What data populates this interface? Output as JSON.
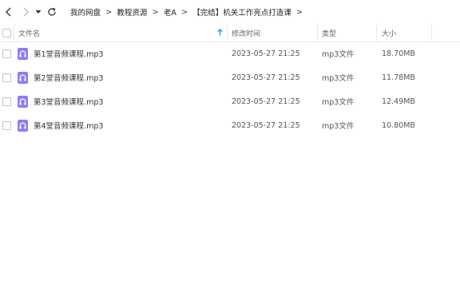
{
  "breadcrumb": [
    "我的网盘",
    "教程资源",
    "老A",
    "【完结】机关工作亮点打造课"
  ],
  "breadcrumb_separator": ">",
  "columns": {
    "name": "文件名",
    "modified": "修改时间",
    "type": "类型",
    "size": "大小"
  },
  "sort": {
    "column": "文件名",
    "direction": "ascending"
  },
  "files": [
    {
      "name": "第1堂音频课程.mp3",
      "modified": "2023-05-27 21:25",
      "type": "mp3文件",
      "size": "18.70MB",
      "icon": "audio-file-icon"
    },
    {
      "name": "第2堂音频课程.mp3",
      "modified": "2023-05-27 21:25",
      "type": "mp3文件",
      "size": "11.78MB",
      "icon": "audio-file-icon"
    },
    {
      "name": "第3堂音频课程.mp3",
      "modified": "2023-05-27 21:25",
      "type": "mp3文件",
      "size": "12.49MB",
      "icon": "audio-file-icon"
    },
    {
      "name": "第4堂音频课程.mp3",
      "modified": "2023-05-27 21:25",
      "type": "mp3文件",
      "size": "10.80MB",
      "icon": "audio-file-icon"
    }
  ],
  "colors": {
    "accent": "#1e8be8",
    "file_icon": "#8c7ef2",
    "border": "#ececec"
  }
}
